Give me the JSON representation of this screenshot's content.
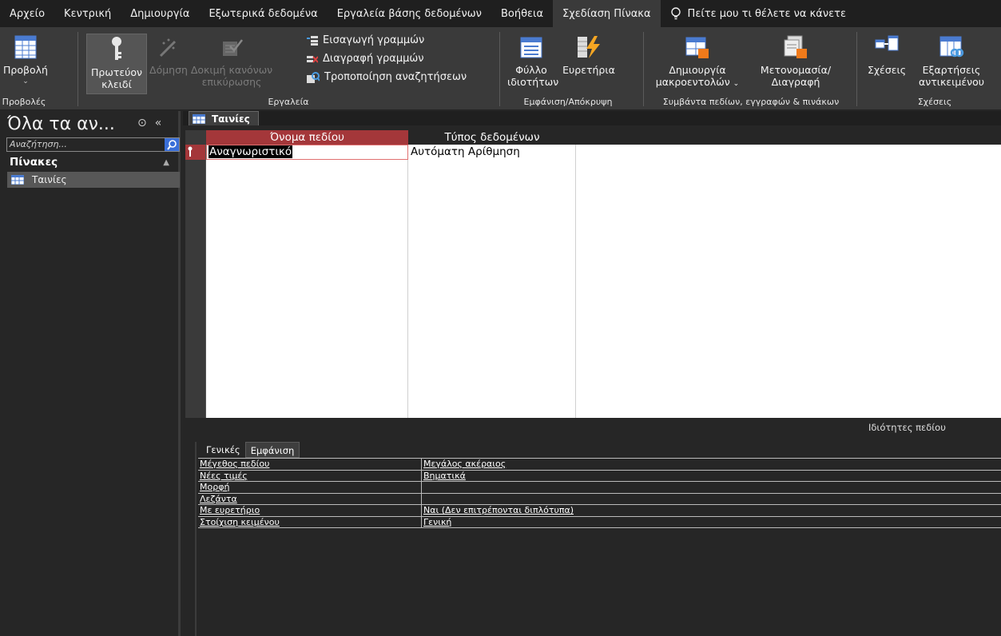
{
  "tabs": [
    "Αρχείο",
    "Κεντρική",
    "Δημιουργία",
    "Εξωτερικά δεδομένα",
    "Εργαλεία βάσης δεδομένων",
    "Βοήθεια",
    "Σχεδίαση Πίνακα"
  ],
  "active_tab": "Σχεδίαση Πίνακα",
  "tell_me": "Πείτε μου τι θέλετε να κάνετε",
  "ribbon": {
    "view_btn": "Προβολή",
    "view_group": "Προβολές",
    "primary_key_l1": "Πρωτεύον",
    "primary_key_l2": "κλειδί",
    "builder": "Δόμηση",
    "test_rules_l1": "Δοκιμή κανόνων",
    "test_rules_l2": "επικύρωσης",
    "insert_rows": "Εισαγωγή γραμμών",
    "delete_rows": "Διαγραφή γραμμών",
    "modify_lookups": "Τροποποίηση αναζητήσεων",
    "tools_group": "Εργαλεία",
    "property_sheet_l1": "Φύλλο",
    "property_sheet_l2": "ιδιοτήτων",
    "indexes": "Ευρετήρια",
    "show_hide_group": "Εμφάνιση/Απόκρυψη",
    "create_macros_l1": "Δημιουργία",
    "create_macros_l2": "μακροεντολών",
    "rename_delete_l1": "Μετονομασία/",
    "rename_delete_l2": "Διαγραφή",
    "events_group": "Συμβάντα πεδίων, εγγραφών & πινάκων",
    "relationships": "Σχέσεις",
    "dependencies_l1": "Εξαρτήσεις",
    "dependencies_l2": "αντικειμένου",
    "relationships_group": "Σχέσεις"
  },
  "nav": {
    "title": "Όλα τα αν...",
    "search_placeholder": "Αναζήτηση...",
    "section": "Πίνακες",
    "items": [
      "Ταινίες"
    ]
  },
  "document": {
    "tab_label": "Ταινίες",
    "col_field_name": "Όνομα πεδίου",
    "col_data_type": "Τύπος δεδομένων",
    "rows": [
      {
        "field": "Αναγνωριστικό",
        "type": "Αυτόματη Αρίθμηση",
        "primary_key": true
      }
    ],
    "empty_rows": 17
  },
  "properties": {
    "label": "Ιδιότητες πεδίου",
    "tabs": [
      "Γενικές",
      "Εμφάνιση"
    ],
    "rows": [
      {
        "name": "Μέγεθος πεδίου",
        "value": "Μεγάλος ακέραιος"
      },
      {
        "name": "Νέες τιμές",
        "value": "Βηματικά"
      },
      {
        "name": "Μορφή",
        "value": ""
      },
      {
        "name": "Λεζάντα",
        "value": ""
      },
      {
        "name": "Με ευρετήριο",
        "value": "Ναι (Δεν επιτρέπονται διπλότυπα)"
      },
      {
        "name": "Στοίχιση κειμένου",
        "value": "Γενική"
      }
    ]
  },
  "colors": {
    "accent_red": "#a4373a",
    "search_blue": "#3a6fd8"
  }
}
